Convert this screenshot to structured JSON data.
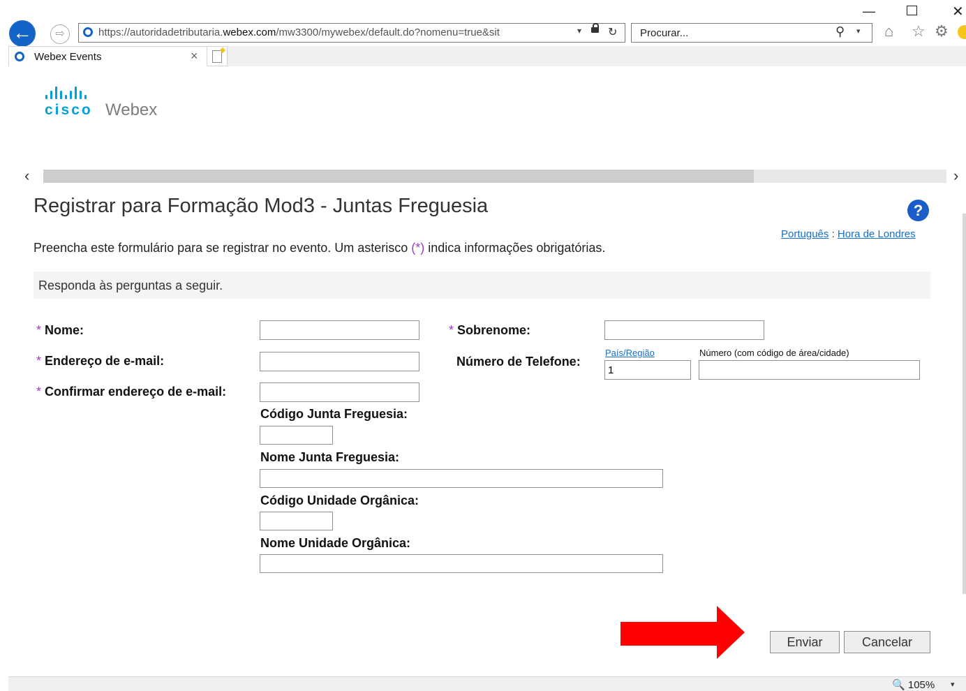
{
  "browser": {
    "address_bar": {
      "url_prefix": "https://autoridadetributaria.",
      "url_domain": "webex.com",
      "url_suffix": "/mw3300/mywebex/default.do?nomenu=true&sit"
    },
    "search_placeholder": "Procurar...",
    "tab_title": "Webex Events",
    "zoom": "105%"
  },
  "logo": {
    "cisco": "cisco",
    "webex": "Webex"
  },
  "page": {
    "title": "Registrar para Formação Mod3 - Juntas Freguesia",
    "language_link": "Português",
    "separator": ":",
    "timezone_link": "Hora de Londres",
    "intro_before": "Preencha este formulário para se registrar no evento. Um asterisco ",
    "intro_required": "(*)",
    "intro_after": " indica informações obrigatórias.",
    "questions_header": "Responda às perguntas a seguir."
  },
  "form": {
    "required_mark": "*",
    "first_name_label": "Nome:",
    "last_name_label": "Sobrenome:",
    "email_label": "Endereço de e-mail:",
    "confirm_email_label": "Confirmar endereço de e-mail:",
    "phone_label": "Número de Telefone:",
    "country_region_link": "País/Região",
    "phone_number_label": "Número (com código de área/cidade)",
    "country_code_value": "1",
    "junta_code_label": "Código Junta Freguesia:",
    "junta_name_label": "Nome Junta Freguesia:",
    "unit_code_label": "Código Unidade Orgânica:",
    "unit_name_label": "Nome Unidade Orgânica:"
  },
  "buttons": {
    "submit": "Enviar",
    "cancel": "Cancelar"
  },
  "colors": {
    "required_asterisk": "#9b3ec8",
    "link": "#1570c8",
    "annotation_arrow": "#ff0000",
    "brand_cisco": "#049fd9"
  }
}
